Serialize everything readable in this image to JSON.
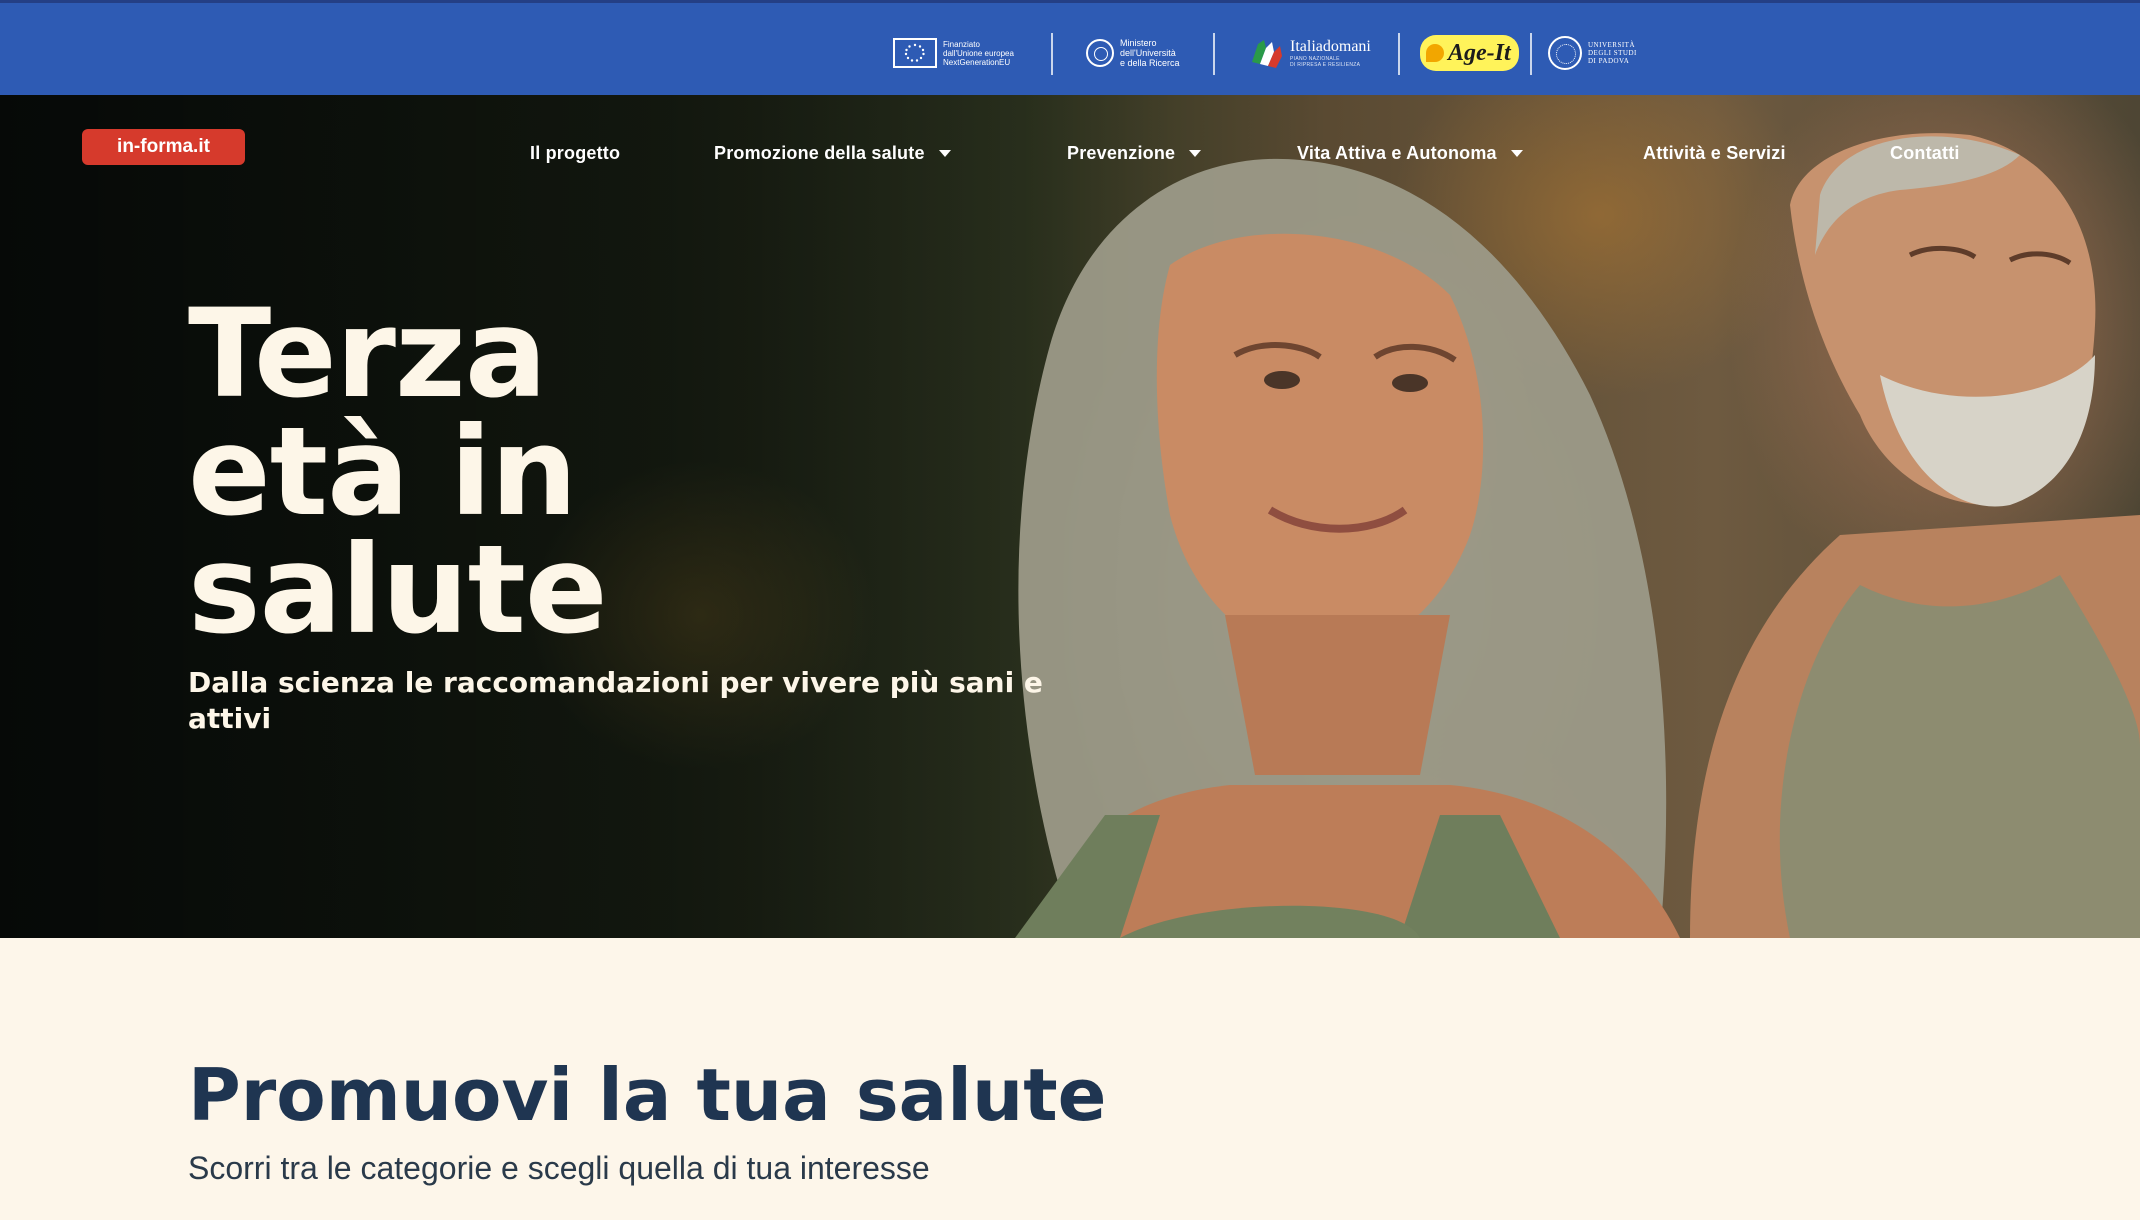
{
  "partner_bar": {
    "eu": {
      "line1": "Finanziato",
      "line2": "dall'Unione europea",
      "line3": "NextGenerationEU"
    },
    "mur": {
      "line1": "Ministero",
      "line2": "dell'Università",
      "line3": "e della Ricerca"
    },
    "italiadomani": {
      "name": "Italiadomani",
      "sub1": "PIANO NAZIONALE",
      "sub2": "DI RIPRESA E RESILIENZA"
    },
    "ageit": {
      "name": "Age-It"
    },
    "unipd": {
      "line1": "UNIVERSITÀ",
      "line2": "DEGLI STUDI",
      "line3": "DI PADOVA"
    }
  },
  "header": {
    "logo": "in-forma.it",
    "nav": [
      {
        "label": "Il progetto"
      },
      {
        "label": "Promozione della salute"
      },
      {
        "label": "Prevenzione"
      },
      {
        "label": "Vita Attiva e Autonoma"
      },
      {
        "label": "Attività e Servizi"
      },
      {
        "label": "Contatti"
      }
    ]
  },
  "hero": {
    "title_line1": "Terza",
    "title_line2": "età in",
    "title_line3": "salute",
    "subtitle": "Dalla scienza le raccomandazioni per vivere più sani e attivi"
  },
  "section": {
    "title": "Promuovi la tua salute",
    "subtitle": "Scorri tra le categorie e scegli quella di tua interesse"
  },
  "colors": {
    "top_bar": "#2e5bb4",
    "logo_badge": "#d63a2c",
    "page_background": "#fdf6ea",
    "heading": "#1f3551"
  }
}
